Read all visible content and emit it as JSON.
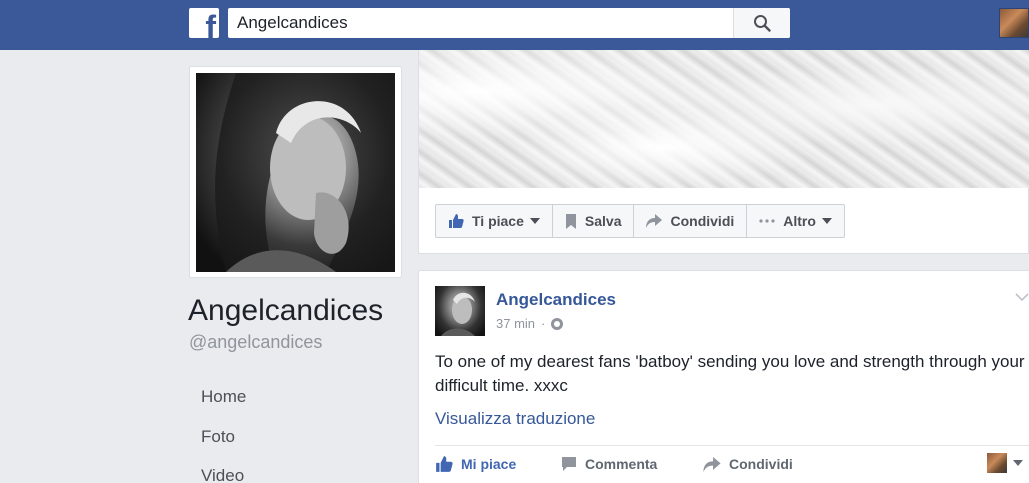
{
  "topbar": {
    "logo": "f",
    "search_value": "Angelcandices",
    "icons": {
      "search": "search-icon",
      "profile": "avatar"
    }
  },
  "profile": {
    "name": "Angelcandices",
    "handle": "@angelcandices"
  },
  "nav": {
    "items": [
      {
        "label": "Home"
      },
      {
        "label": "Foto"
      },
      {
        "label": "Video"
      }
    ]
  },
  "page_actions": {
    "like": "Ti piace",
    "save": "Salva",
    "share": "Condividi",
    "more": "Altro"
  },
  "post": {
    "author": "Angelcandices",
    "time": "37 min",
    "separator": "·",
    "text": "To one of my dearest fans 'batboy' sending you love and strength through your difficult time. xxxc",
    "translate": "Visualizza traduzione",
    "actions": {
      "like": "Mi piace",
      "comment": "Commenta",
      "share": "Condividi"
    }
  },
  "colors": {
    "brand": "#3b5998",
    "link": "#365899",
    "liked": "#4267b2",
    "background": "#e9ebee"
  }
}
